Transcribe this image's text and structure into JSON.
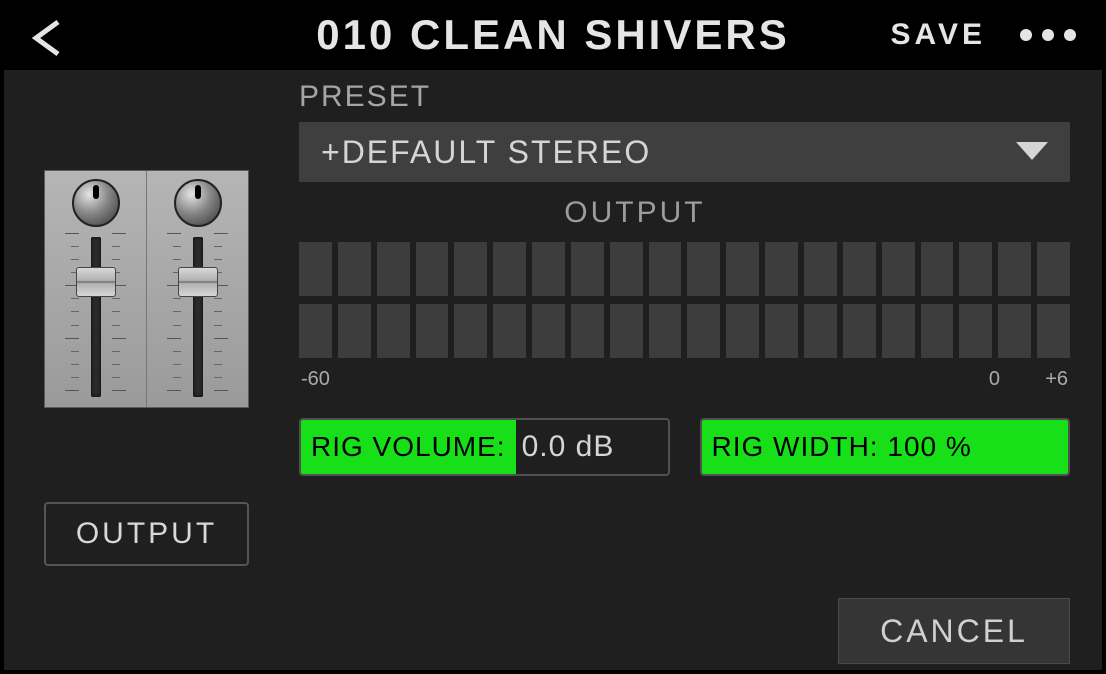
{
  "header": {
    "title": "010 CLEAN SHIVERS",
    "save": "SAVE"
  },
  "preset": {
    "label": "PRESET",
    "value": "+DEFAULT STEREO"
  },
  "output": {
    "label": "OUTPUT",
    "meter_segments": 20,
    "scale_min": "-60",
    "scale_zero": "0",
    "scale_max": "+6"
  },
  "rig_volume": {
    "label": "RIG VOLUME:",
    "value": "0.0 dB"
  },
  "rig_width": {
    "label": "RIG WIDTH: 100 %"
  },
  "output_button": "OUTPUT",
  "cancel": "CANCEL",
  "colors": {
    "accent_green": "#18e018"
  }
}
